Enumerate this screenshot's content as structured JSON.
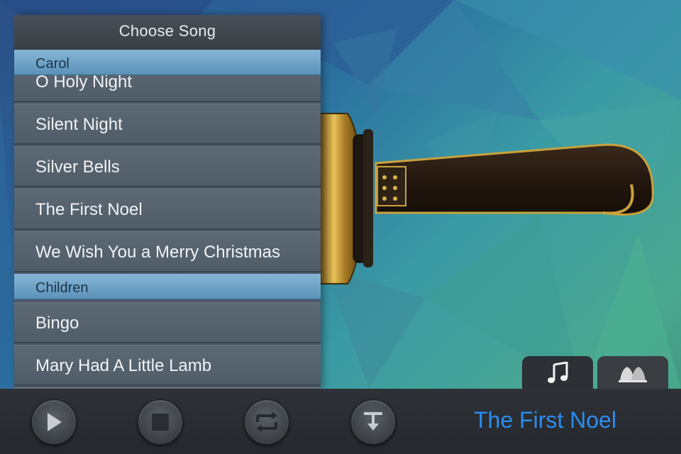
{
  "panel": {
    "title": "Choose Song",
    "sections": [
      {
        "name": "Carol",
        "songs": [
          "O Holy Night",
          "Silent Night",
          "Silver Bells",
          "The First Noel",
          "We Wish You a Merry Christmas"
        ]
      },
      {
        "name": "Children",
        "songs": [
          "Bingo",
          "Mary Had A Little Lamb"
        ]
      }
    ]
  },
  "tabs": [
    {
      "icon": "music-note-icon",
      "active": true
    },
    {
      "icon": "bells-icon",
      "active": false
    }
  ],
  "toolbar": {
    "buttons": [
      {
        "icon": "play-icon",
        "enabled": true
      },
      {
        "icon": "stop-icon",
        "enabled": false
      },
      {
        "icon": "repeat-icon",
        "enabled": false
      },
      {
        "icon": "tempo-icon",
        "enabled": true
      }
    ],
    "now_playing": "The First Noel"
  },
  "colors": {
    "accent": "#2c8df0",
    "section": "#6fa6c9",
    "row": "#56626e"
  }
}
